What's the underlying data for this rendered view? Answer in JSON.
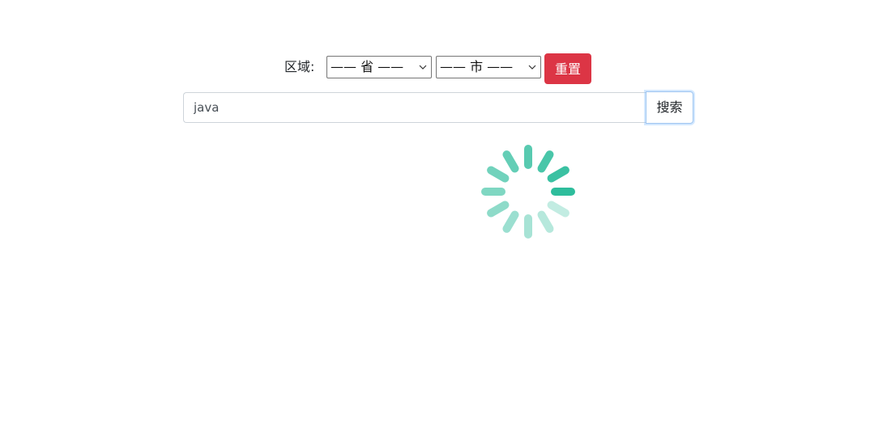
{
  "region": {
    "label": "区域:",
    "province_select": {
      "selected": "—— 省 ——"
    },
    "city_select": {
      "selected": "—— 市 ——"
    },
    "reset_label": "重置"
  },
  "search": {
    "value": "java",
    "button_label": "搜索"
  },
  "spinner": {
    "icon": "loading-spinner-icon",
    "color": "#2ebd9c"
  },
  "colors": {
    "reset_button": "#dc3545",
    "spinner": "#2ebd9c"
  }
}
